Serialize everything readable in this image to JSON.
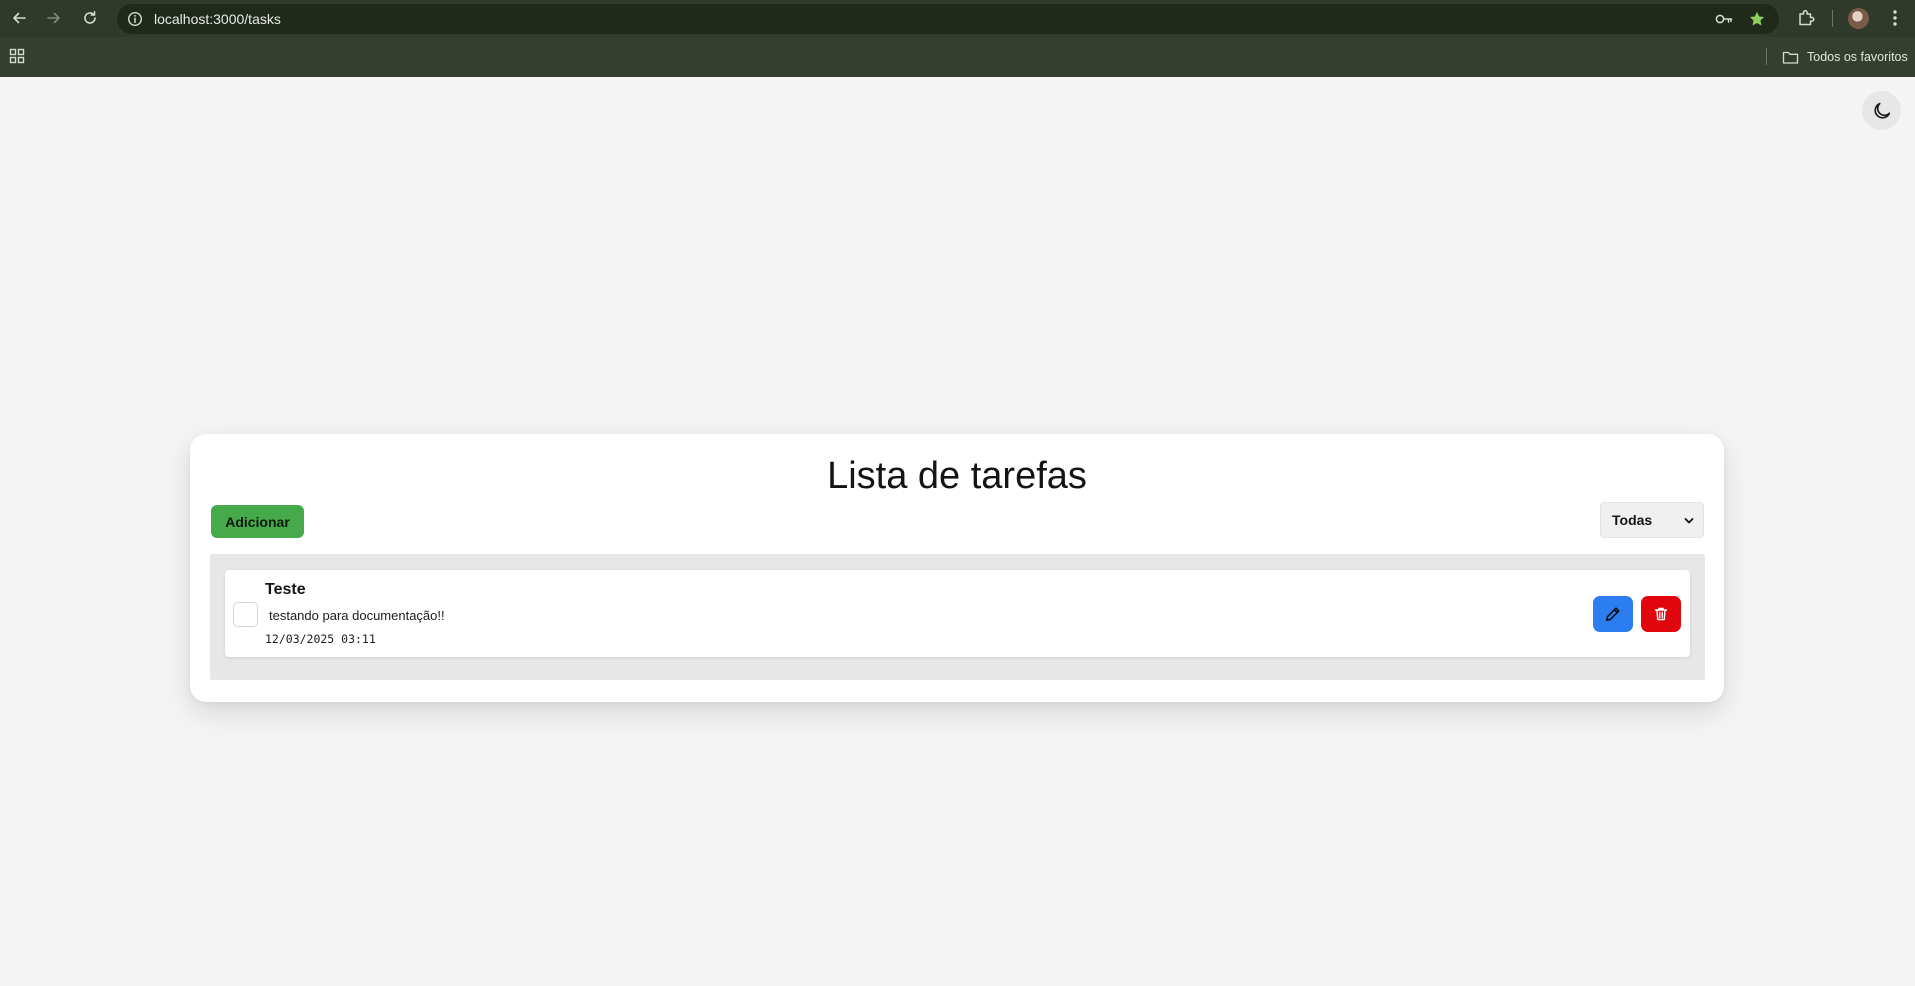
{
  "browser": {
    "url": "localhost:3000/tasks",
    "bookmarks_folder": "Todos os favoritos",
    "icons": [
      "back-icon",
      "forward-icon",
      "reload-icon",
      "site-info-icon",
      "password-key-icon",
      "bookmark-star-icon",
      "extensions-icon",
      "profile-avatar",
      "menu-dots-icon",
      "apps-grid-icon",
      "folder-icon"
    ],
    "colors": {
      "toolbar": "#2f3a2b",
      "omnibox": "#1f2a1b",
      "bookmarks_bar": "#343f30",
      "star": "#8fce5c"
    }
  },
  "page": {
    "theme_toggle_icon": "moon-icon",
    "title": "Lista de tarefas",
    "add_button": "Adicionar",
    "filter": {
      "selected": "Todas"
    },
    "tasks": [
      {
        "title": "Teste",
        "description": "testando para documentação!!",
        "date": "12/03/2025 03:11",
        "completed": false,
        "actions": {
          "edit_icon": "pencil-icon",
          "delete_icon": "trash-icon"
        }
      }
    ],
    "colors": {
      "background": "#f4f4f4",
      "add_button": "#46a94a",
      "edit_button": "#2b7df0",
      "delete_button": "#e1060e",
      "list_area": "#e8e7e7"
    }
  }
}
